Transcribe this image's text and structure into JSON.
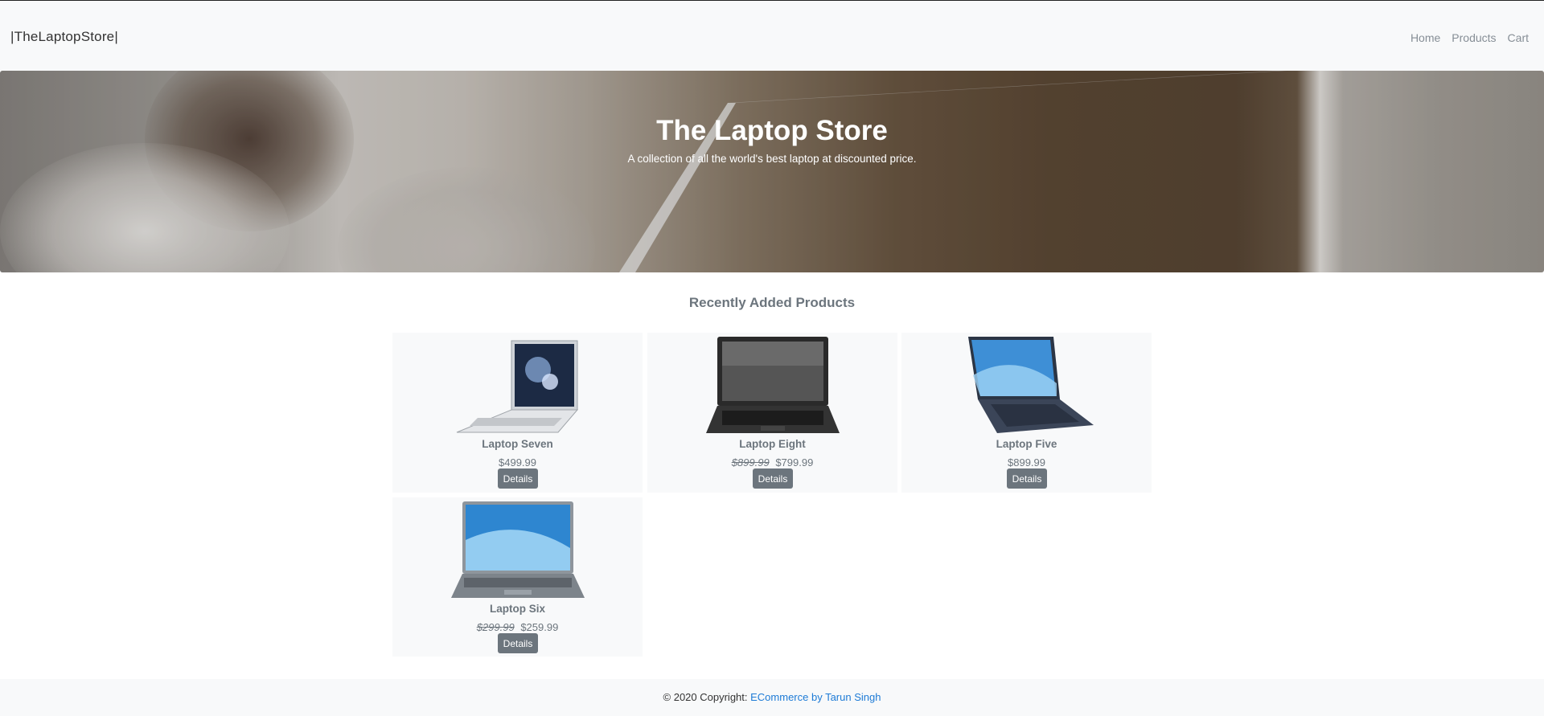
{
  "navbar": {
    "brand": "|TheLaptopStore|",
    "links": [
      "Home",
      "Products",
      "Cart"
    ]
  },
  "hero": {
    "title": "The Laptop Store",
    "subtitle": "A collection of all the world's best laptop at discounted price."
  },
  "section": {
    "title": "Recently Added Products"
  },
  "products": [
    {
      "name": "Laptop Seven",
      "old_price": "",
      "price": "$499.99",
      "button": "Details",
      "image": "silver-laptop-icon"
    },
    {
      "name": "Laptop Eight",
      "old_price": "$899.99",
      "price": "$799.99",
      "button": "Details",
      "image": "black-laptop-icon"
    },
    {
      "name": "Laptop Five",
      "old_price": "",
      "price": "$899.99",
      "button": "Details",
      "image": "blue-laptop-icon"
    },
    {
      "name": "Laptop Six",
      "old_price": "$299.99",
      "price": "$259.99",
      "button": "Details",
      "image": "grey-laptop-icon"
    }
  ],
  "footer": {
    "prefix": "© 2020 Copyright: ",
    "link": "ECommerce by Tarun Singh"
  },
  "colors": {
    "link_blue": "#1e7bd6",
    "button_grey": "#6c757d",
    "card_bg": "#f8f9fa"
  }
}
